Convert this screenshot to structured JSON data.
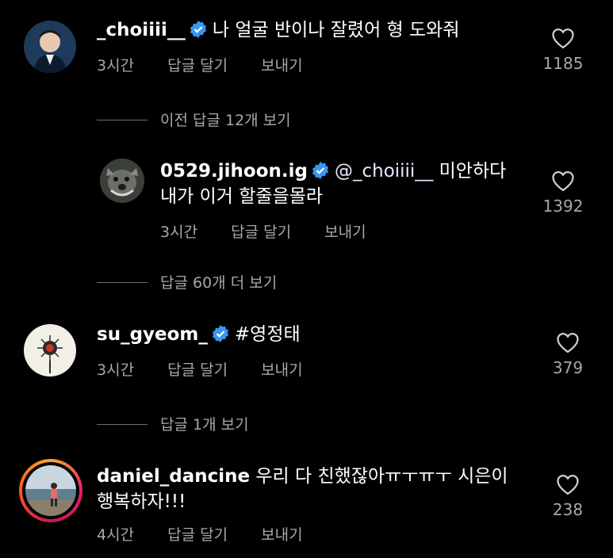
{
  "comments": [
    {
      "username": "_choiiii__",
      "text": "나 얼굴 반이나 잘렸어 형 도와줘",
      "time": "3시간",
      "reply": "답글 달기",
      "send": "보내기",
      "likes": "1185"
    },
    {
      "username": "0529.jihoon.ig",
      "mention": "@_choiiii__",
      "text": "미안하다",
      "text2": "내가 이거 할줄을몰라",
      "time": "3시간",
      "reply": "답글 달기",
      "send": "보내기",
      "likes": "1392"
    },
    {
      "username": "su_gyeom_",
      "text": "#영정태",
      "time": "3시간",
      "reply": "답글 달기",
      "send": "보내기",
      "likes": "379"
    },
    {
      "username": "daniel_dancine",
      "text": "우리 다 친했잖아ㅠㅜㅠㅜ 시은이",
      "text2": "행복하자!!!",
      "time": "4시간",
      "reply": "답글 달기",
      "send": "보내기",
      "likes": "238"
    }
  ],
  "view_more": {
    "previous_replies": "이전 답글 12개 보기",
    "replies_60": "답글 60개 더 보기",
    "replies_1": "답글 1개 보기"
  },
  "colors": {
    "background": "#000000",
    "secondary_text": "#a8a8a8",
    "verified": "#3897f0"
  }
}
